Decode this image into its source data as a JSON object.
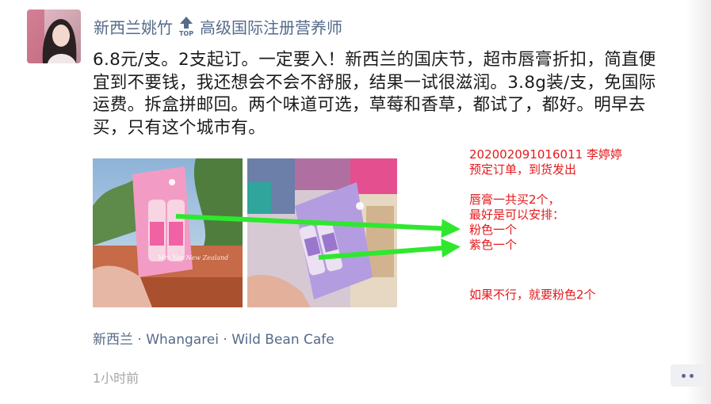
{
  "post": {
    "author_name": "新西兰姚竹",
    "top_badge_label": "TOP",
    "author_title": "高级国际注册营养师",
    "text_lines": [
      "6.8元/支。2支起订。一定要入！新西兰的国庆节，超市唇膏折扣，简直便",
      "宜到不要钱，我还想会不会不舒服，结果一试很滋润。3.8g装/支，免国际",
      "运费。拆盒拼邮回。两个味道可选，草莓和香草，都试了，都好。明早去",
      "买，只有这个城市有。"
    ],
    "photo_watermark": "Mrs Yao New Zealand",
    "location": "新西兰 · Whangarei · Wild Bean Cafe",
    "timestamp": "1小时前"
  },
  "annotation": {
    "lines": [
      "202002091016011    李婷婷",
      "预定订单，到货发出",
      "",
      "唇膏一共买2个，",
      "最好是可以安排：",
      "粉色一个",
      "紫色一个"
    ],
    "note": "如果不行，就要粉色2个",
    "text_color": "#e3191c",
    "arrow_color": "#2ee82e"
  },
  "colors": {
    "name_link": "#566a8a",
    "timestamp": "#a6a6a6",
    "body_text": "#1b1b1b"
  },
  "icons": [
    "top-badge-icon",
    "more-options-icon"
  ]
}
